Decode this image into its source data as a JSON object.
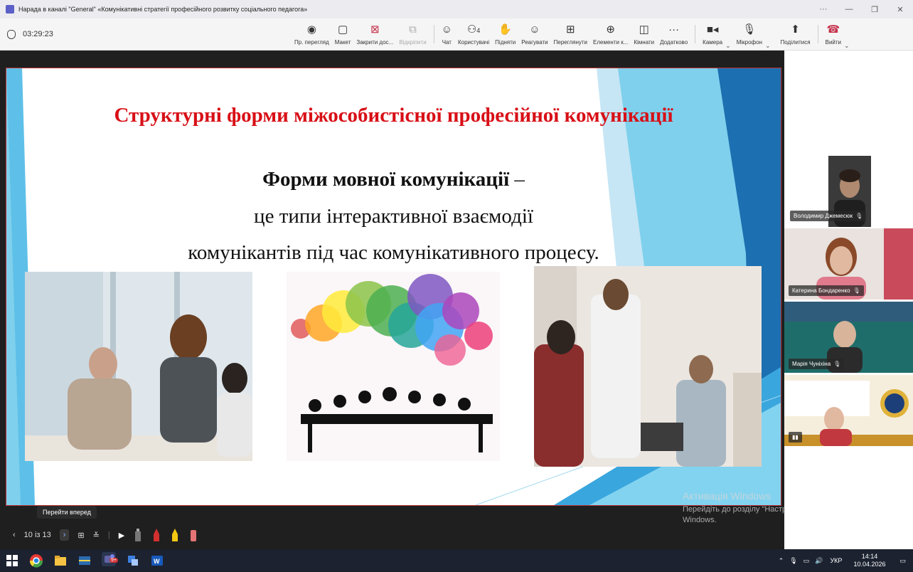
{
  "window": {
    "title": "Нарада в каналі \"General\" «Комунікативні стратегії професійного розвитку соціального педагога»"
  },
  "meeting": {
    "timer": "03:29:23"
  },
  "toolbar": {
    "items": [
      {
        "label": "Пр. перегляд",
        "icon": "eye-icon"
      },
      {
        "label": "Макет",
        "icon": "layout-icon"
      },
      {
        "label": "Закрити дос...",
        "icon": "close-share-icon"
      },
      {
        "label": "Відкріпити",
        "icon": "unpin-icon"
      },
      {
        "label": "Чат",
        "icon": "chat-icon"
      },
      {
        "label": "Користувачі",
        "icon": "people-icon",
        "badge": "4"
      },
      {
        "label": "Підняти",
        "icon": "hand-icon"
      },
      {
        "label": "Реагувати",
        "icon": "smile-icon"
      },
      {
        "label": "Переглянути",
        "icon": "view-icon"
      },
      {
        "label": "Елементи к...",
        "icon": "apps-icon"
      },
      {
        "label": "Кімнати",
        "icon": "rooms-icon"
      },
      {
        "label": "Додатково",
        "icon": "more-icon"
      },
      {
        "label": "Камера",
        "icon": "camera-icon"
      },
      {
        "label": "Мікрофон",
        "icon": "mic-icon"
      },
      {
        "label": "Поділитися",
        "icon": "share-icon"
      },
      {
        "label": "Вийти",
        "icon": "hangup-icon"
      }
    ]
  },
  "slide": {
    "title": "Структурні форми міжособистісної професійної комунікації",
    "term": "Форми мовної комунікації",
    "dash": " –",
    "line2": "це типи інтерактивної взаємодії",
    "line3": "комунікантів під час комунікативного процесу."
  },
  "controls": {
    "tooltip": "Перейти вперед",
    "page_indicator": "10 із 13"
  },
  "participants": [
    {
      "name": "Володимир Джемесюк"
    },
    {
      "name": "Катерина Бондаренко"
    },
    {
      "name": "Марія Чуніхіна"
    },
    {
      "name": ""
    }
  ],
  "activation": {
    "title": "Активація Windows",
    "body": "Перейдіть до розділу \"Настройки\", щоб активувати Windows."
  },
  "taskbar": {
    "lang": "УКР",
    "time": "14:14",
    "date": "10.04.2026",
    "teams_badge": "9+"
  }
}
